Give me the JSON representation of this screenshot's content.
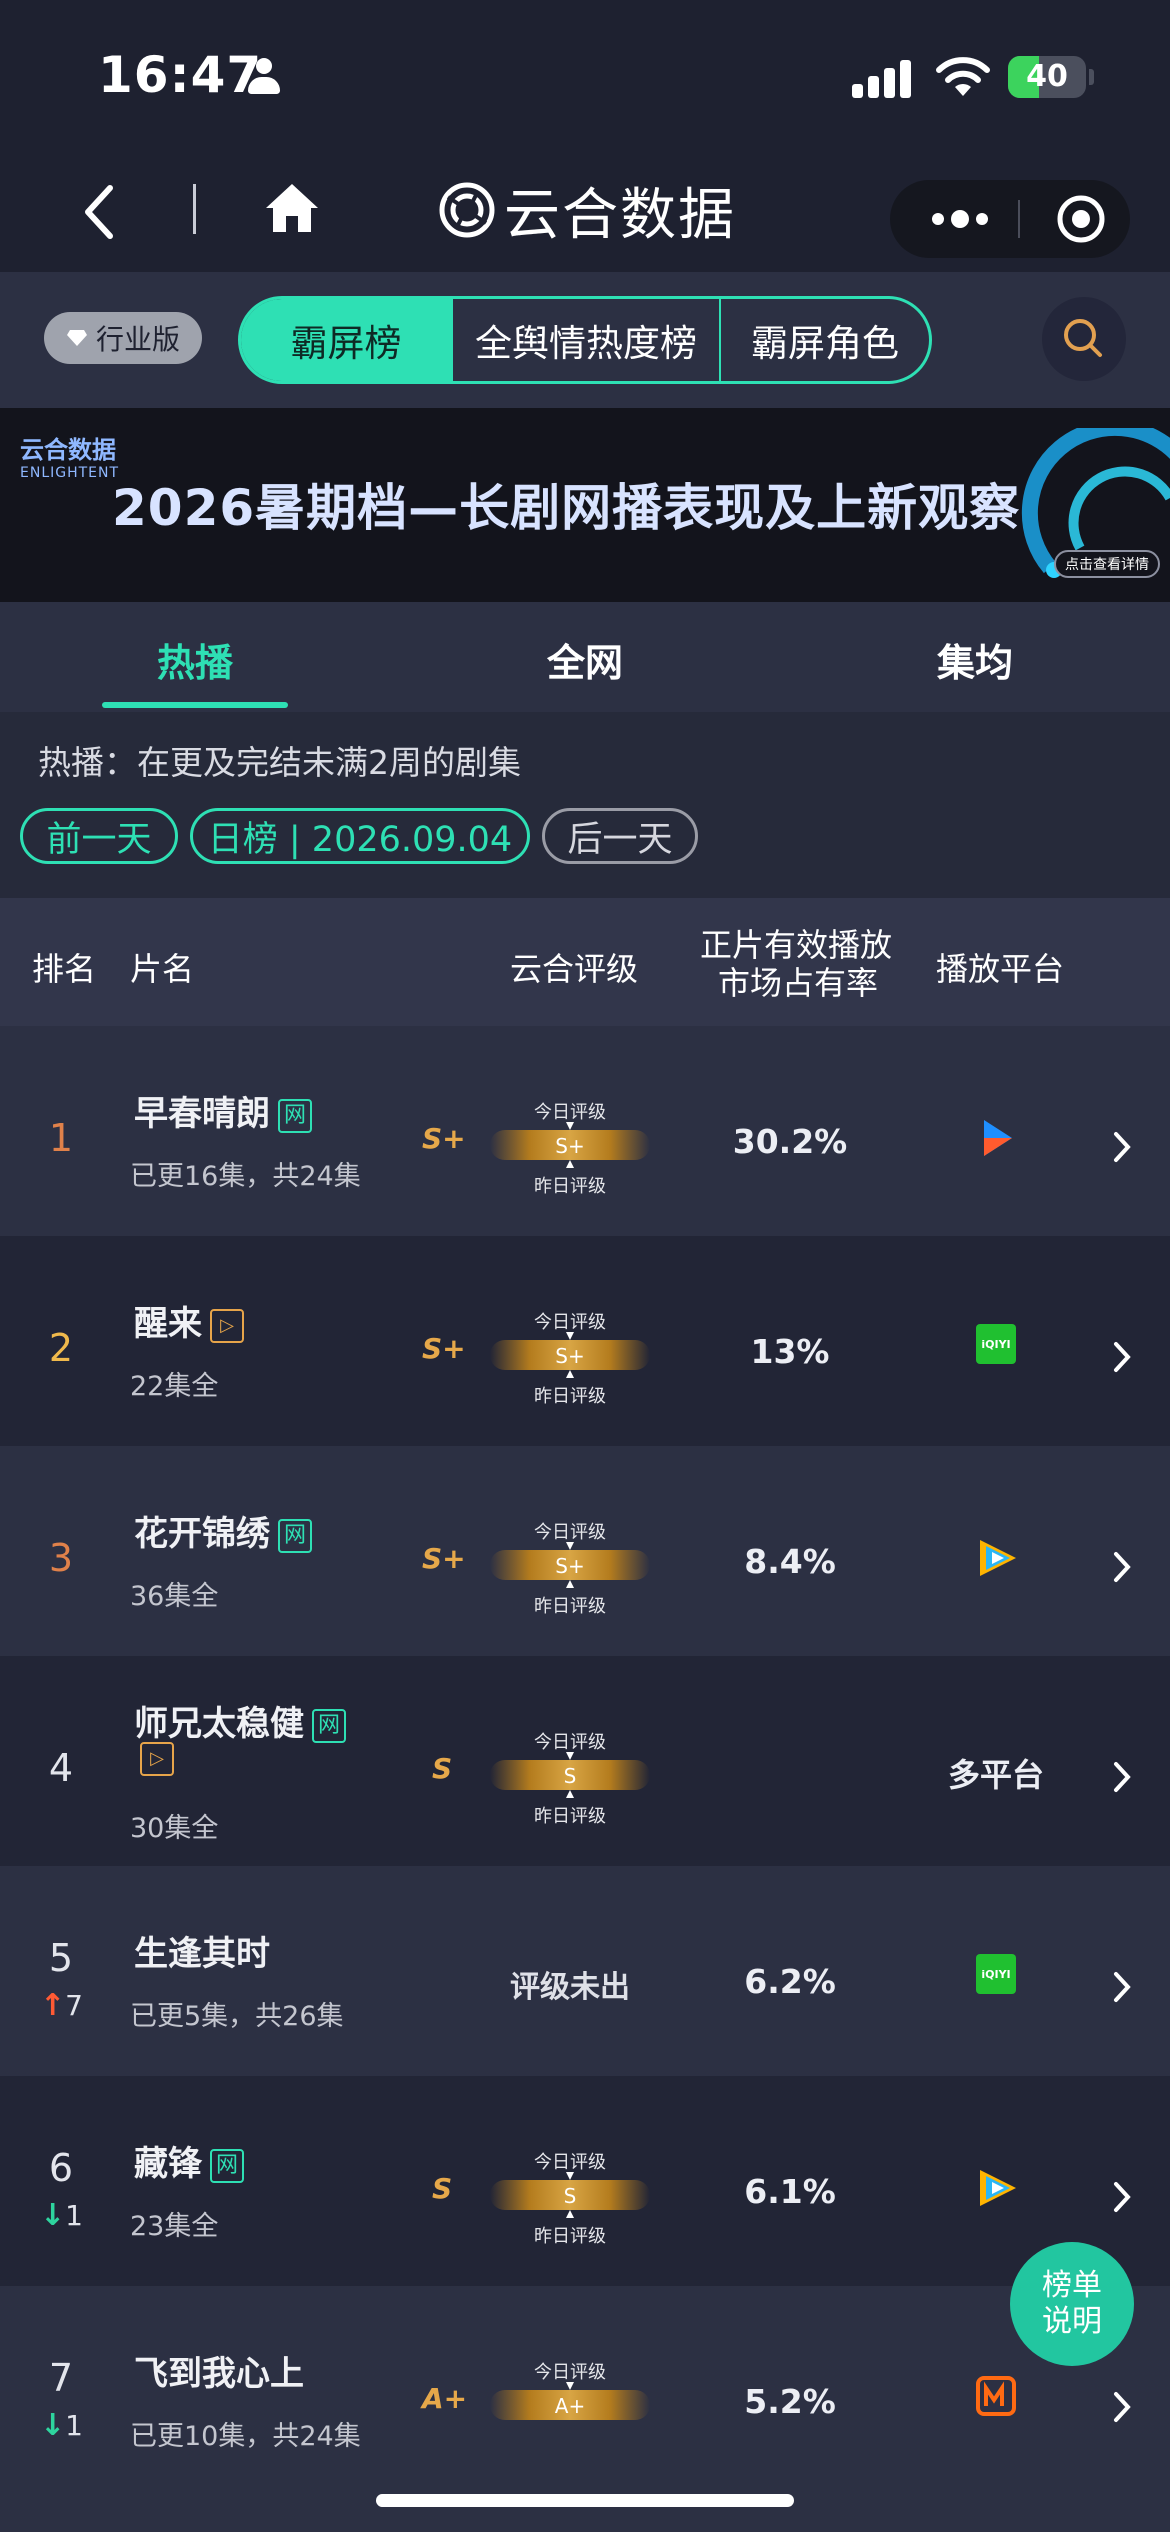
{
  "status_bar": {
    "time": "16:47",
    "battery": "40",
    "battery_level": 0.4
  },
  "nav": {
    "title": "云合数据"
  },
  "toolbar": {
    "edition": "行业版",
    "segments": [
      "霸屏榜",
      "全舆情热度榜",
      "霸屏角色"
    ]
  },
  "banner": {
    "logo_cn": "云合数据",
    "logo_en": "ENLIGHTENT",
    "title": "2026暑期档—长剧网播表现及上新观察",
    "cta": "点击查看详情"
  },
  "subtabs": [
    "热播",
    "全网",
    "集均"
  ],
  "info": {
    "desc": "热播：在更及完结未满2周的剧集",
    "prev": "前一天",
    "date_label": "日榜 | 2026.09.04",
    "next": "后一天"
  },
  "table": {
    "headers": {
      "rank": "排名",
      "title": "片名",
      "rating": "云合评级",
      "share_l1": "正片有效播放",
      "share_l2": "市场占有率",
      "platform": "播放平台"
    },
    "today_label": "今日评级",
    "yesterday_label": "昨日评级",
    "rows": [
      {
        "rank": "1",
        "title": "早春晴朗",
        "sub": "已更16集，共24集",
        "grade": "S+",
        "bar_grade": "S+",
        "share": "30.2%",
        "platform": "youku"
      },
      {
        "rank": "2",
        "title": "醒来",
        "sub": "22集全",
        "grade": "S+",
        "bar_grade": "S+",
        "share": "13%",
        "platform": "iqiyi",
        "iqiyi": "iQIYI"
      },
      {
        "rank": "3",
        "title": "花开锦绣",
        "sub": "36集全",
        "grade": "S+",
        "bar_grade": "S+",
        "share": "8.4%",
        "platform": "tencent"
      },
      {
        "rank": "4",
        "title": "师兄太稳健",
        "sub": "30集全",
        "grade": "S",
        "bar_grade": "S",
        "share": "",
        "platform_text": "多平台"
      },
      {
        "rank": "5",
        "title": "生逢其时",
        "sub": "已更5集，共26集",
        "norating": "评级未出",
        "share": "6.2%",
        "platform": "iqiyi",
        "iqiyi": "iQIYI",
        "trend": "7"
      },
      {
        "rank": "6",
        "title": "藏锋",
        "sub": "23集全",
        "grade": "S",
        "bar_grade": "S",
        "share": "6.1%",
        "platform": "tencent",
        "trend": "1"
      },
      {
        "rank": "7",
        "title": "飞到我心上",
        "sub": "已更10集，共24集",
        "grade": "A+",
        "bar_grade": "A+",
        "share": "5.2%",
        "platform": "mango",
        "trend": "1"
      }
    ]
  },
  "float_button": {
    "line1": "榜单",
    "line2": "说明"
  },
  "badges": {
    "wang": "网"
  },
  "colors": {
    "accent": "#2ee0b4",
    "gold": "#e6a84a",
    "bg": "#1e2130"
  }
}
